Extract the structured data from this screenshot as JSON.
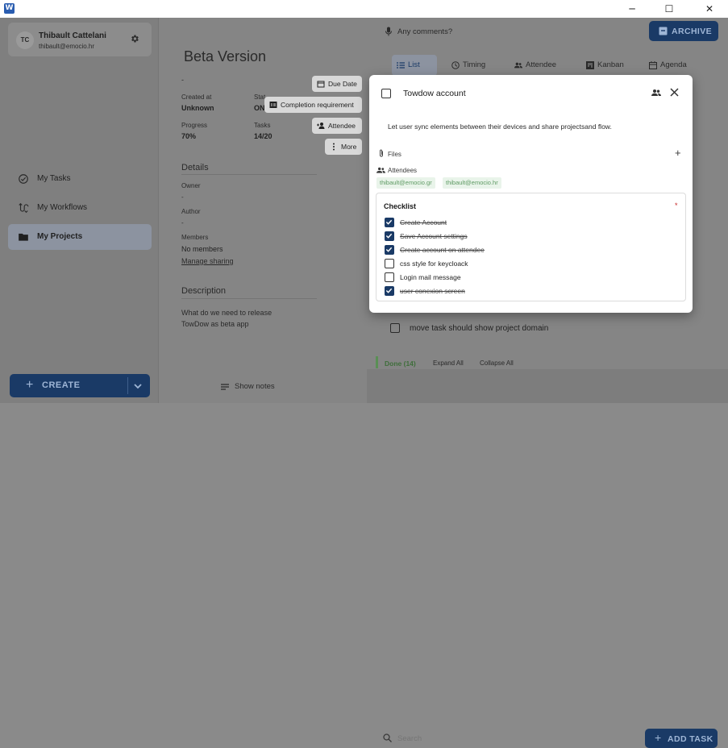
{
  "window": {
    "app_icon": "W",
    "minimize": "─",
    "maximize": "☐",
    "close": "✕"
  },
  "user": {
    "initials": "TC",
    "name": "Thibault Cattelani",
    "email": "thibault@emocio.hr"
  },
  "sidebar": {
    "items": [
      {
        "label": "My Tasks",
        "icon": "check-circle-icon"
      },
      {
        "label": "My Workflows",
        "icon": "workflow-icon"
      },
      {
        "label": "My Projects",
        "icon": "folder-icon",
        "active": true
      }
    ],
    "create_label": "CREATE"
  },
  "project": {
    "title": "Beta Version",
    "dash": "-",
    "created_at_label": "Created at",
    "created_at_value": "Unknown",
    "status_label": "Stat",
    "status_value": "ON",
    "progress_label": "Progress",
    "progress_value": "70%",
    "tasks_label": "Tasks",
    "tasks_value": "14/20",
    "details_title": "Details",
    "owner_label": "Owner",
    "owner_value": "-",
    "author_label": "Author",
    "author_value": "-",
    "members_label": "Members",
    "members_value": "No members",
    "manage_sharing": "Manage sharing",
    "description_title": "Description",
    "description_line1": "What do we need to release",
    "description_line2": "TowDow as beta app",
    "show_notes": "Show notes"
  },
  "side_actions": {
    "due_date": "Due Date",
    "completion_requirement": "Completion requirement",
    "attendee": "Attendee",
    "more": "More"
  },
  "right": {
    "comments_placeholder": "Any comments?",
    "archive_label": "ARCHIVE",
    "tabs": [
      {
        "label": "List",
        "active": true
      },
      {
        "label": "Timing"
      },
      {
        "label": "Attendee"
      },
      {
        "label": "Kanban"
      },
      {
        "label": "Agenda"
      }
    ],
    "bg_task": "move task should show project domain",
    "done_label": "Done (14)",
    "expand_all": "Expand All",
    "collapse_all": "Collapse All",
    "search_placeholder": "Search",
    "add_task_label": "ADD TASK"
  },
  "modal": {
    "title": "Towdow account",
    "description": "Let user sync elements between their devices and share projectsand flow.",
    "files_label": "Files",
    "files_add": "+",
    "attendees_label": "Attendees",
    "attendees": [
      "thibault@emocio.gr",
      "thibault@emocio.hr"
    ],
    "checklist_title": "Checklist",
    "checklist_required": "*",
    "checklist": [
      {
        "label": "Create Account",
        "checked": true
      },
      {
        "label": "Save Account settings",
        "checked": true
      },
      {
        "label": "Create account on attendee",
        "checked": true
      },
      {
        "label": "css style for keycloack",
        "checked": false
      },
      {
        "label": "Login mail message",
        "checked": false
      },
      {
        "label": "user conexion screen",
        "checked": true
      }
    ]
  },
  "colors": {
    "primary": "#1a3a66",
    "primary_text": "#9fb6d6",
    "done_green": "#5a8f55",
    "chip_bg": "#e9f4ea",
    "chip_text": "#5e9a63",
    "required": "#c62828"
  }
}
